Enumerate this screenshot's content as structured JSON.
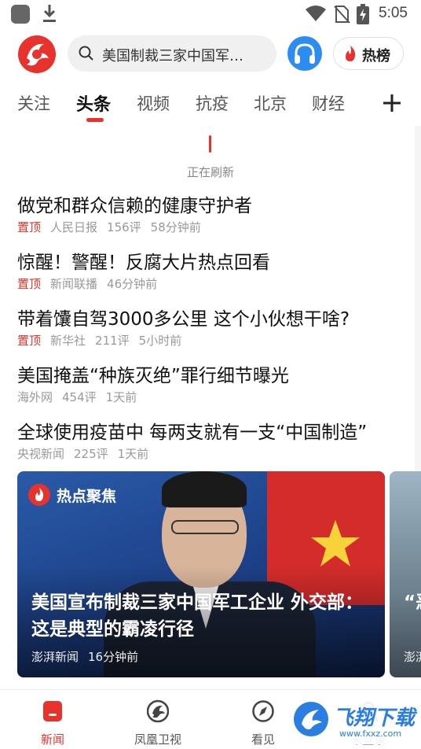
{
  "status_bar": {
    "time": "5:05",
    "icons": [
      "app-icon",
      "download-icon",
      "wifi-icon",
      "no-sim-icon",
      "battery-icon"
    ]
  },
  "header": {
    "logo": "phoenix-logo-icon",
    "search_text": "美国制裁三家中国军…",
    "audio_icon": "headphones-icon",
    "hot_label": "热榜"
  },
  "tabs": {
    "items": [
      "关注",
      "头条",
      "视频",
      "抗疫",
      "北京",
      "财经"
    ],
    "active": "头条",
    "add_icon": "plus-icon"
  },
  "refresh": {
    "text": "正在刷新"
  },
  "news": [
    {
      "title": "做党和群众信赖的健康守护者",
      "pin": "置顶",
      "source": "人民日报",
      "comments": "156评",
      "time": "58分钟前"
    },
    {
      "title": "惊醒！警醒！反腐大片热点回看",
      "pin": "置顶",
      "source": "新闻联播",
      "comments": "",
      "time": "46分钟前"
    },
    {
      "title": "带着馕自驾3000多公里 这个小伙想干啥?",
      "pin": "置顶",
      "source": "新华社",
      "comments": "211评",
      "time": "5小时前"
    },
    {
      "title": "美国掩盖“种族灭绝”罪行细节曝光",
      "pin": "",
      "source": "海外网",
      "comments": "454评",
      "time": "1天前"
    },
    {
      "title": "全球使用疫苗中 每两支就有一支“中国制造”",
      "pin": "",
      "source": "央视新闻",
      "comments": "225评",
      "time": "1天前"
    }
  ],
  "hot_card": {
    "badge": "热点聚焦",
    "title": "美国宣布制裁三家中国军工企业 外交部：这是典型的霸凌行径",
    "source": "澎湃新闻",
    "time": "16分钟前"
  },
  "hot_card_2": {
    "title": "“恶 复",
    "source": "澎湃"
  },
  "bottom_nav": {
    "items": [
      {
        "label": "新闻",
        "icon": "news-icon",
        "active": true
      },
      {
        "label": "凤凰卫视",
        "icon": "phoenix-tv-icon",
        "active": false
      },
      {
        "label": "看见",
        "icon": "compass-icon",
        "active": false
      },
      {
        "label": "未登录",
        "icon": "user-icon",
        "active": false
      }
    ]
  },
  "watermark": {
    "text": "飞翔下载",
    "url": "www.fxxz.com"
  },
  "colors": {
    "accent": "#e8332c",
    "audio_button": "#2d8cf0"
  }
}
